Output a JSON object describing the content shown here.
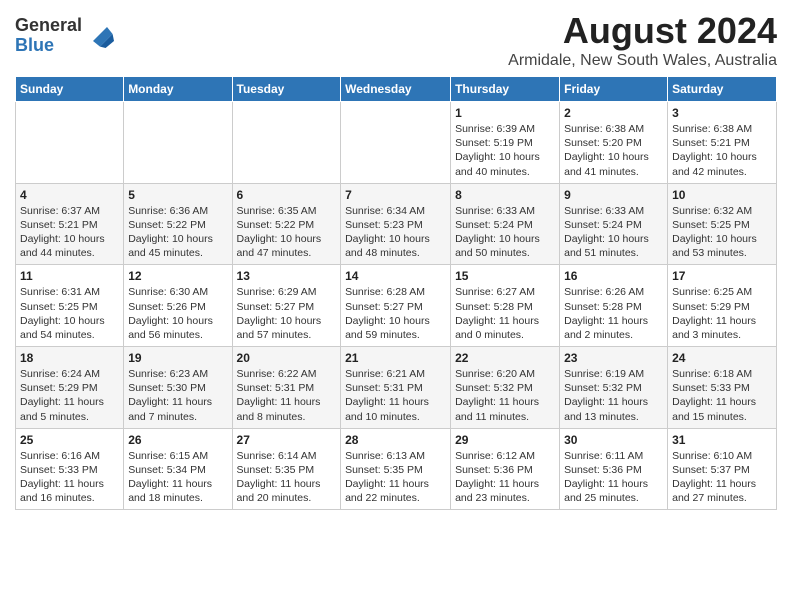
{
  "logo": {
    "general": "General",
    "blue": "Blue"
  },
  "title": "August 2024",
  "subtitle": "Armidale, New South Wales, Australia",
  "weekdays": [
    "Sunday",
    "Monday",
    "Tuesday",
    "Wednesday",
    "Thursday",
    "Friday",
    "Saturday"
  ],
  "weeks": [
    [
      {
        "day": "",
        "info": ""
      },
      {
        "day": "",
        "info": ""
      },
      {
        "day": "",
        "info": ""
      },
      {
        "day": "",
        "info": ""
      },
      {
        "day": "1",
        "info": "Sunrise: 6:39 AM\nSunset: 5:19 PM\nDaylight: 10 hours\nand 40 minutes."
      },
      {
        "day": "2",
        "info": "Sunrise: 6:38 AM\nSunset: 5:20 PM\nDaylight: 10 hours\nand 41 minutes."
      },
      {
        "day": "3",
        "info": "Sunrise: 6:38 AM\nSunset: 5:21 PM\nDaylight: 10 hours\nand 42 minutes."
      }
    ],
    [
      {
        "day": "4",
        "info": "Sunrise: 6:37 AM\nSunset: 5:21 PM\nDaylight: 10 hours\nand 44 minutes."
      },
      {
        "day": "5",
        "info": "Sunrise: 6:36 AM\nSunset: 5:22 PM\nDaylight: 10 hours\nand 45 minutes."
      },
      {
        "day": "6",
        "info": "Sunrise: 6:35 AM\nSunset: 5:22 PM\nDaylight: 10 hours\nand 47 minutes."
      },
      {
        "day": "7",
        "info": "Sunrise: 6:34 AM\nSunset: 5:23 PM\nDaylight: 10 hours\nand 48 minutes."
      },
      {
        "day": "8",
        "info": "Sunrise: 6:33 AM\nSunset: 5:24 PM\nDaylight: 10 hours\nand 50 minutes."
      },
      {
        "day": "9",
        "info": "Sunrise: 6:33 AM\nSunset: 5:24 PM\nDaylight: 10 hours\nand 51 minutes."
      },
      {
        "day": "10",
        "info": "Sunrise: 6:32 AM\nSunset: 5:25 PM\nDaylight: 10 hours\nand 53 minutes."
      }
    ],
    [
      {
        "day": "11",
        "info": "Sunrise: 6:31 AM\nSunset: 5:25 PM\nDaylight: 10 hours\nand 54 minutes."
      },
      {
        "day": "12",
        "info": "Sunrise: 6:30 AM\nSunset: 5:26 PM\nDaylight: 10 hours\nand 56 minutes."
      },
      {
        "day": "13",
        "info": "Sunrise: 6:29 AM\nSunset: 5:27 PM\nDaylight: 10 hours\nand 57 minutes."
      },
      {
        "day": "14",
        "info": "Sunrise: 6:28 AM\nSunset: 5:27 PM\nDaylight: 10 hours\nand 59 minutes."
      },
      {
        "day": "15",
        "info": "Sunrise: 6:27 AM\nSunset: 5:28 PM\nDaylight: 11 hours\nand 0 minutes."
      },
      {
        "day": "16",
        "info": "Sunrise: 6:26 AM\nSunset: 5:28 PM\nDaylight: 11 hours\nand 2 minutes."
      },
      {
        "day": "17",
        "info": "Sunrise: 6:25 AM\nSunset: 5:29 PM\nDaylight: 11 hours\nand 3 minutes."
      }
    ],
    [
      {
        "day": "18",
        "info": "Sunrise: 6:24 AM\nSunset: 5:29 PM\nDaylight: 11 hours\nand 5 minutes."
      },
      {
        "day": "19",
        "info": "Sunrise: 6:23 AM\nSunset: 5:30 PM\nDaylight: 11 hours\nand 7 minutes."
      },
      {
        "day": "20",
        "info": "Sunrise: 6:22 AM\nSunset: 5:31 PM\nDaylight: 11 hours\nand 8 minutes."
      },
      {
        "day": "21",
        "info": "Sunrise: 6:21 AM\nSunset: 5:31 PM\nDaylight: 11 hours\nand 10 minutes."
      },
      {
        "day": "22",
        "info": "Sunrise: 6:20 AM\nSunset: 5:32 PM\nDaylight: 11 hours\nand 11 minutes."
      },
      {
        "day": "23",
        "info": "Sunrise: 6:19 AM\nSunset: 5:32 PM\nDaylight: 11 hours\nand 13 minutes."
      },
      {
        "day": "24",
        "info": "Sunrise: 6:18 AM\nSunset: 5:33 PM\nDaylight: 11 hours\nand 15 minutes."
      }
    ],
    [
      {
        "day": "25",
        "info": "Sunrise: 6:16 AM\nSunset: 5:33 PM\nDaylight: 11 hours\nand 16 minutes."
      },
      {
        "day": "26",
        "info": "Sunrise: 6:15 AM\nSunset: 5:34 PM\nDaylight: 11 hours\nand 18 minutes."
      },
      {
        "day": "27",
        "info": "Sunrise: 6:14 AM\nSunset: 5:35 PM\nDaylight: 11 hours\nand 20 minutes."
      },
      {
        "day": "28",
        "info": "Sunrise: 6:13 AM\nSunset: 5:35 PM\nDaylight: 11 hours\nand 22 minutes."
      },
      {
        "day": "29",
        "info": "Sunrise: 6:12 AM\nSunset: 5:36 PM\nDaylight: 11 hours\nand 23 minutes."
      },
      {
        "day": "30",
        "info": "Sunrise: 6:11 AM\nSunset: 5:36 PM\nDaylight: 11 hours\nand 25 minutes."
      },
      {
        "day": "31",
        "info": "Sunrise: 6:10 AM\nSunset: 5:37 PM\nDaylight: 11 hours\nand 27 minutes."
      }
    ]
  ]
}
